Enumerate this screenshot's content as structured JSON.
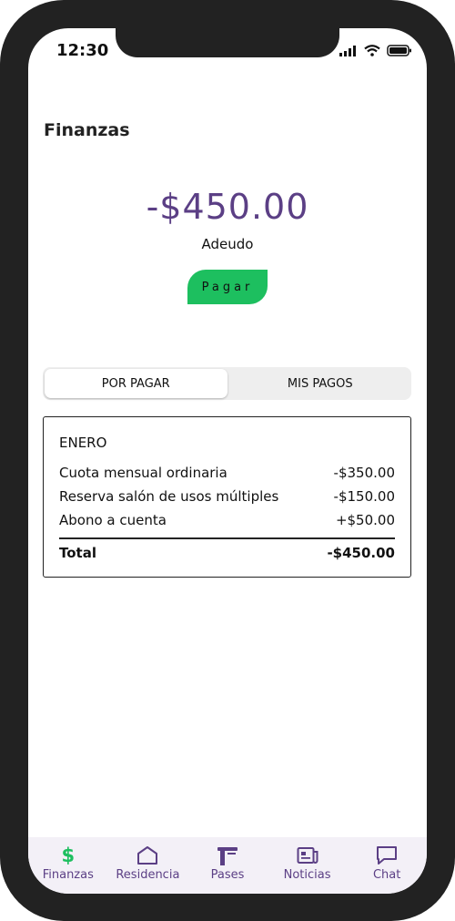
{
  "status_bar": {
    "time": "12:30"
  },
  "page": {
    "title": "Finanzas"
  },
  "balance": {
    "amount": "-$450.00",
    "label": "Adeudo",
    "pay_button": "Pagar"
  },
  "tabs": [
    {
      "label": "POR PAGAR",
      "active": true
    },
    {
      "label": "MIS PAGOS",
      "active": false
    }
  ],
  "statement": {
    "month": "ENERO",
    "items": [
      {
        "label": "Cuota mensual ordinaria",
        "amount": "-$350.00"
      },
      {
        "label": "Reserva salón de usos múltiples",
        "amount": "-$150.00"
      },
      {
        "label": "Abono a cuenta",
        "amount": "+$50.00"
      }
    ],
    "total": {
      "label": "Total",
      "amount": "-$450.00"
    }
  },
  "nav": [
    {
      "label": "Finanzas",
      "icon": "dollar-icon",
      "active": true
    },
    {
      "label": "Residencia",
      "icon": "house-icon"
    },
    {
      "label": "Pases",
      "icon": "gate-icon"
    },
    {
      "label": "Noticias",
      "icon": "newspaper-icon"
    },
    {
      "label": "Chat",
      "icon": "chat-bubble-icon"
    }
  ],
  "colors": {
    "accent": "#5b3f85",
    "green": "#1dbf5f"
  }
}
